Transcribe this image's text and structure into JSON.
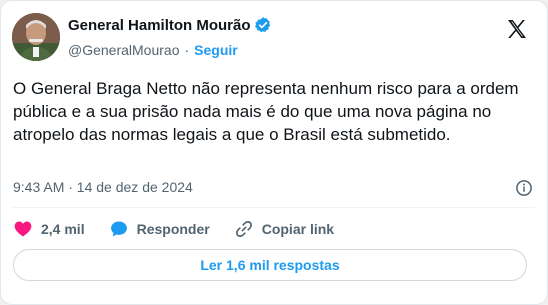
{
  "author": {
    "display_name": "General Hamilton Mourão",
    "handle": "@GeneralMourao",
    "separator": "·",
    "follow_label": "Seguir",
    "verified_color": "#1d9bf0"
  },
  "tweet": {
    "text": "O General Braga Netto não representa nenhum risco para a ordem pública e a sua prisão nada mais é do que uma nova página no atropelo das normas legais a que o Brasil está submetido.",
    "timestamp": "9:43 AM · 14 de dez de 2024"
  },
  "actions": {
    "likes_label": "2,4 mil",
    "reply_label": "Responder",
    "copy_link_label": "Copiar link",
    "like_color": "#f91880",
    "reply_color": "#1d9bf0"
  },
  "replies_button_label": "Ler 1,6 mil respostas",
  "icons": {
    "brand": "x-logo-icon",
    "info": "info-icon",
    "like": "heart-icon",
    "reply": "speech-bubble-icon",
    "copy": "link-icon"
  }
}
